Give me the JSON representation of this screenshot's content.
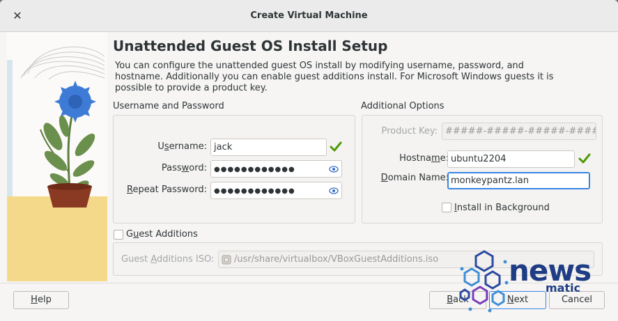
{
  "window": {
    "title": "Create Virtual Machine"
  },
  "page": {
    "heading": "Unattended Guest OS Install Setup",
    "description": "You can configure the unattended guest OS install by modifying username, password, and hostname. Additionally you can enable guest additions install. For Microsoft Windows guests it is possible to provide a product key."
  },
  "userpass": {
    "group_title": "Username and Password",
    "username_label_pre": "U",
    "username_label_u": "s",
    "username_label_post": "ername:",
    "username_value": "jack",
    "password_label_pre": "Pass",
    "password_label_u": "w",
    "password_label_post": "ord:",
    "password_value": "●●●●●●●●●●●●",
    "repeat_label_u": "R",
    "repeat_label_post": "epeat Password:",
    "repeat_value": "●●●●●●●●●●●●"
  },
  "options": {
    "group_title": "Additional Options",
    "product_key_label": "Product Key:",
    "product_key_placeholder": "#####-#####-#####-#####",
    "hostname_label_pre": "Hostna",
    "hostname_label_u": "m",
    "hostname_label_post": "e:",
    "hostname_value": "ubuntu2204",
    "domain_label_u": "D",
    "domain_label_post": "omain Name:",
    "domain_value": "monkeypantz.lan",
    "install_bg_label_u": "I",
    "install_bg_label_post": "nstall in Background",
    "install_bg_checked": false
  },
  "guest_additions": {
    "checkbox_label_pre": "G",
    "checkbox_label_u": "u",
    "checkbox_label_post": "est Additions",
    "checked": false,
    "iso_label_pre": "Guest ",
    "iso_label_u": "A",
    "iso_label_post": "dditions ISO:",
    "iso_path": "/usr/share/virtualbox/VBoxGuestAdditions.iso"
  },
  "buttons": {
    "help_pre": "",
    "help_u": "H",
    "help_post": "elp",
    "back_pre": "",
    "back_u": "B",
    "back_post": "ack",
    "next_pre": "",
    "next_u": "N",
    "next_post": "ext",
    "cancel": "Cancel"
  },
  "watermark": {
    "line1": "news",
    "line2": "matic"
  },
  "colors": {
    "accent": "#3584e4",
    "check": "#4e9a06",
    "brand": "#1f3d84"
  }
}
